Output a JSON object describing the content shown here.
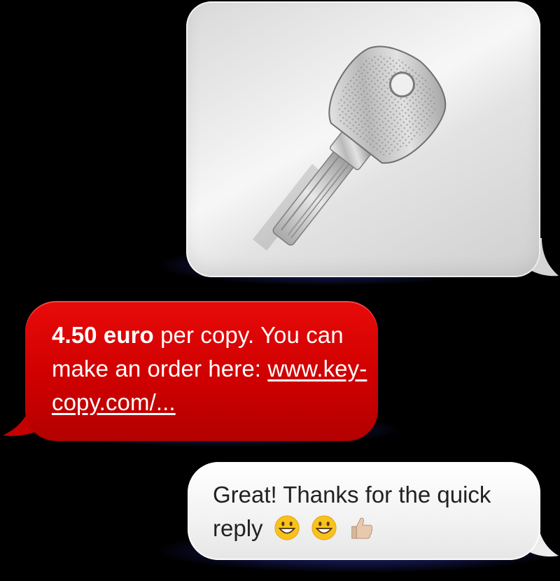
{
  "messages": {
    "incoming_image": {
      "description_icon": "key-photo"
    },
    "outgoing_red": {
      "price": "4.50 euro",
      "text_after_price": " per copy. You can make an order here: ",
      "link": "www.key-copy.com/...",
      "bubble_color": "#d60000"
    },
    "reply_white": {
      "text": "Great! Thanks for the quick reply",
      "emojis": [
        "grinning-face-icon",
        "grinning-face-icon",
        "thumbs-up-icon"
      ],
      "bubble_color": "#f5f5f5"
    }
  }
}
